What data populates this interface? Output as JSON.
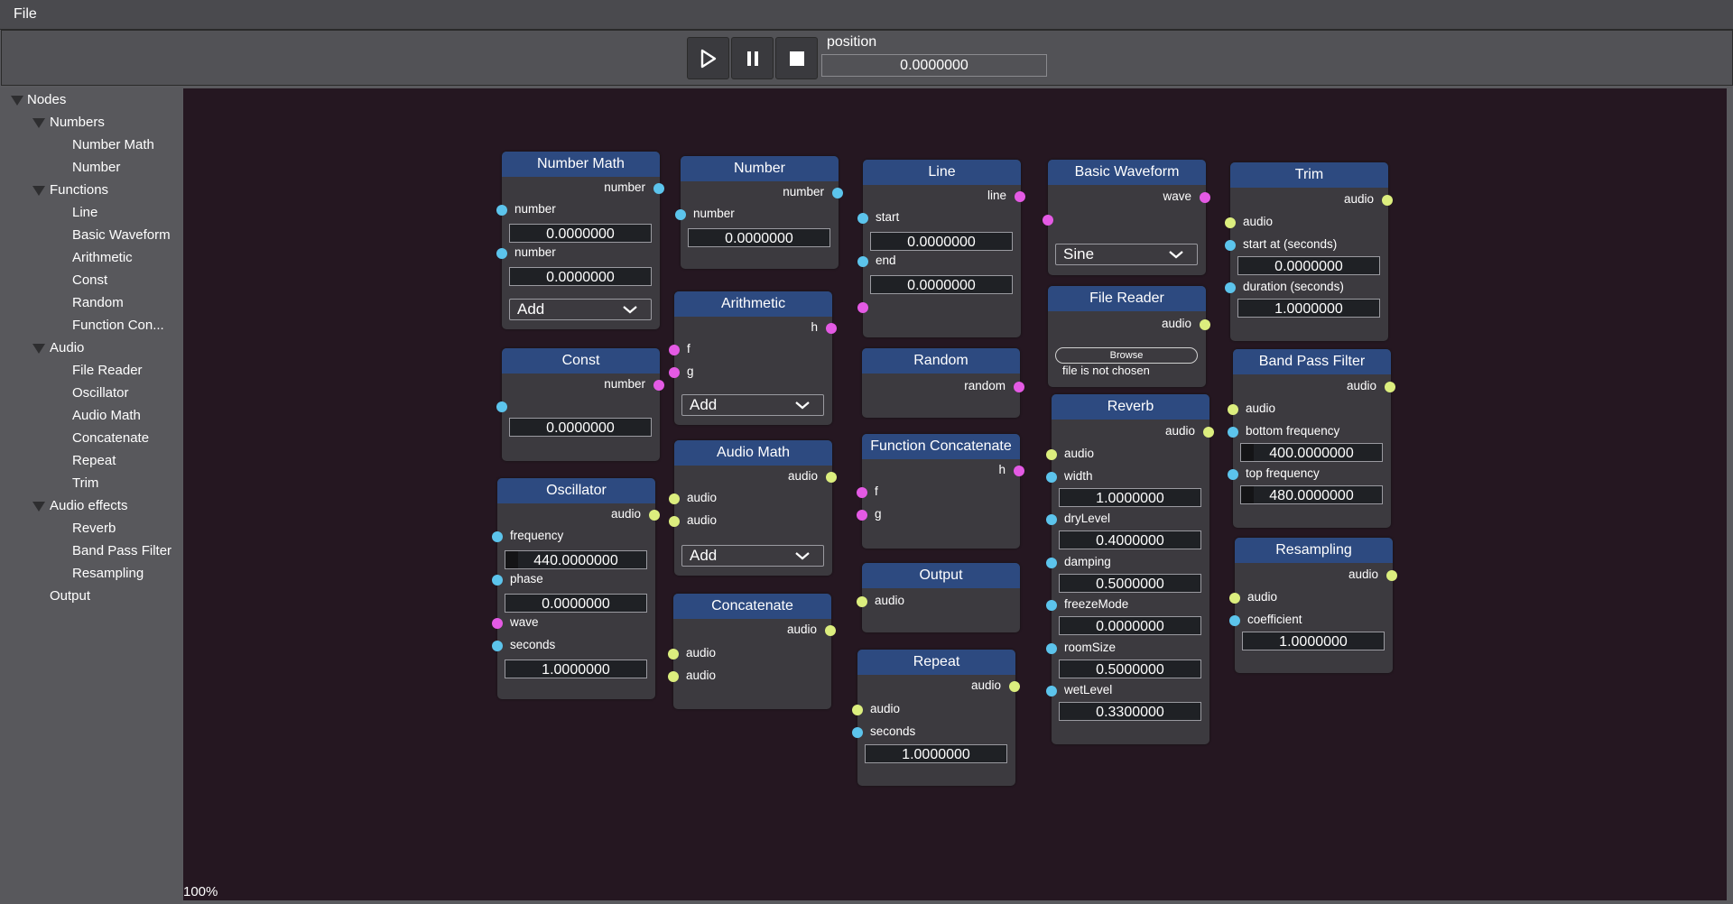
{
  "menu": {
    "file": "File"
  },
  "transport": {
    "position_label": "position",
    "position_value": "0.0000000"
  },
  "sidebar": {
    "root": "Nodes",
    "numbers": "Numbers",
    "number_math": "Number Math",
    "number": "Number",
    "functions": "Functions",
    "line": "Line",
    "basic_waveform": "Basic Waveform",
    "arithmetic": "Arithmetic",
    "const": "Const",
    "random": "Random",
    "function_con": "Function Con...",
    "audio": "Audio",
    "file_reader": "File Reader",
    "oscillator": "Oscillator",
    "audio_math": "Audio Math",
    "concatenate": "Concatenate",
    "repeat": "Repeat",
    "trim": "Trim",
    "audio_effects": "Audio effects",
    "reverb": "Reverb",
    "band_pass_filter": "Band Pass Filter",
    "resampling": "Resampling",
    "output": "Output"
  },
  "zoom": "100%",
  "nodes": {
    "number_math": {
      "title": "Number Math",
      "out": "number",
      "in1": "number",
      "v1": "0.0000000",
      "in2": "number",
      "v2": "0.0000000",
      "op": "Add"
    },
    "const": {
      "title": "Const",
      "out": "number",
      "v1": "0.0000000"
    },
    "oscillator": {
      "title": "Oscillator",
      "out": "audio",
      "in1": "frequency",
      "v1": "440.0000000",
      "in2": "phase",
      "v2": "0.0000000",
      "in3": "wave",
      "in4": "seconds",
      "v4": "1.0000000"
    },
    "number": {
      "title": "Number",
      "out": "number",
      "in1": "number",
      "v1": "0.0000000"
    },
    "arithmetic": {
      "title": "Arithmetic",
      "out": "h",
      "in1": "f",
      "in2": "g",
      "op": "Add"
    },
    "audio_math": {
      "title": "Audio Math",
      "out": "audio",
      "in1": "audio",
      "in2": "audio",
      "op": "Add"
    },
    "concatenate": {
      "title": "Concatenate",
      "out": "audio",
      "in1": "audio",
      "in2": "audio"
    },
    "line": {
      "title": "Line",
      "out": "line",
      "in1": "start",
      "v1": "0.0000000",
      "in2": "end",
      "v2": "0.0000000"
    },
    "random": {
      "title": "Random",
      "out": "random"
    },
    "function_concatenate": {
      "title": "Function Concatenate",
      "out": "h",
      "in1": "f",
      "in2": "g"
    },
    "output": {
      "title": "Output",
      "in1": "audio"
    },
    "repeat": {
      "title": "Repeat",
      "out": "audio",
      "in1": "audio",
      "in2": "seconds",
      "v2": "1.0000000"
    },
    "basic_waveform": {
      "title": "Basic Waveform",
      "out": "wave",
      "op": "Sine"
    },
    "file_reader": {
      "title": "File Reader",
      "out": "audio",
      "browse": "Browse",
      "status": "file is not chosen"
    },
    "reverb": {
      "title": "Reverb",
      "out": "audio",
      "in1": "audio",
      "in2": "width",
      "v2": "1.0000000",
      "in3": "dryLevel",
      "v3": "0.4000000",
      "in4": "damping",
      "v4": "0.5000000",
      "in5": "freezeMode",
      "v5": "0.0000000",
      "in6": "roomSize",
      "v6": "0.5000000",
      "in7": "wetLevel",
      "v7": "0.3300000"
    },
    "trim": {
      "title": "Trim",
      "out": "audio",
      "in1": "audio",
      "in2": "start at (seconds)",
      "v2": "0.0000000",
      "in3": "duration (seconds)",
      "v3": "1.0000000"
    },
    "band_pass": {
      "title": "Band Pass Filter",
      "out": "audio",
      "in1": "audio",
      "in2": "bottom frequency",
      "v2": "400.0000000",
      "in3": "top frequency",
      "v3": "480.0000000"
    },
    "resampling": {
      "title": "Resampling",
      "out": "audio",
      "in1": "audio",
      "in2": "coefficient",
      "v2": "1.0000000"
    }
  }
}
